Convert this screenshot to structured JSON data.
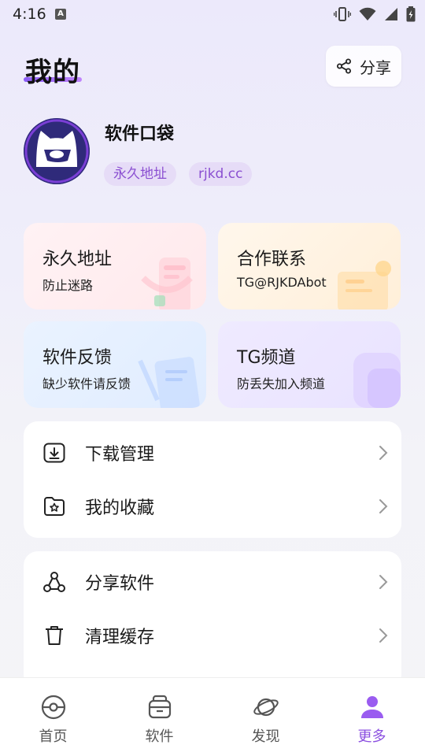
{
  "status_bar": {
    "time": "4:16"
  },
  "header": {
    "title": "我的",
    "share_label": "分享"
  },
  "profile": {
    "name": "软件口袋",
    "tags": [
      "永久地址",
      "rjkd.cc"
    ]
  },
  "feature_cards": [
    {
      "title": "永久地址",
      "subtitle": "防止迷路"
    },
    {
      "title": "合作联系",
      "subtitle": "TG@RJKDAbot"
    },
    {
      "title": "软件反馈",
      "subtitle": "缺少软件请反馈"
    },
    {
      "title": "TG频道",
      "subtitle": "防丢失加入频道"
    }
  ],
  "menu_group_1": [
    {
      "label": "下载管理",
      "icon": "download-icon"
    },
    {
      "label": "我的收藏",
      "icon": "favorites-folder-icon"
    }
  ],
  "menu_group_2": [
    {
      "label": "分享软件",
      "icon": "share-nodes-icon"
    },
    {
      "label": "清理缓存",
      "icon": "trash-icon"
    }
  ],
  "bottom_nav": {
    "items": [
      {
        "label": "首页",
        "icon": "home-pokeball-icon"
      },
      {
        "label": "软件",
        "icon": "basket-icon"
      },
      {
        "label": "发现",
        "icon": "planet-icon"
      },
      {
        "label": "更多",
        "icon": "user-icon"
      }
    ],
    "active_index": 3,
    "active_color": "#8b4fe0"
  },
  "colors": {
    "accent": "#8b5cf6",
    "tag_bg": "#e6dcf7",
    "tag_text": "#8a4fd1"
  }
}
